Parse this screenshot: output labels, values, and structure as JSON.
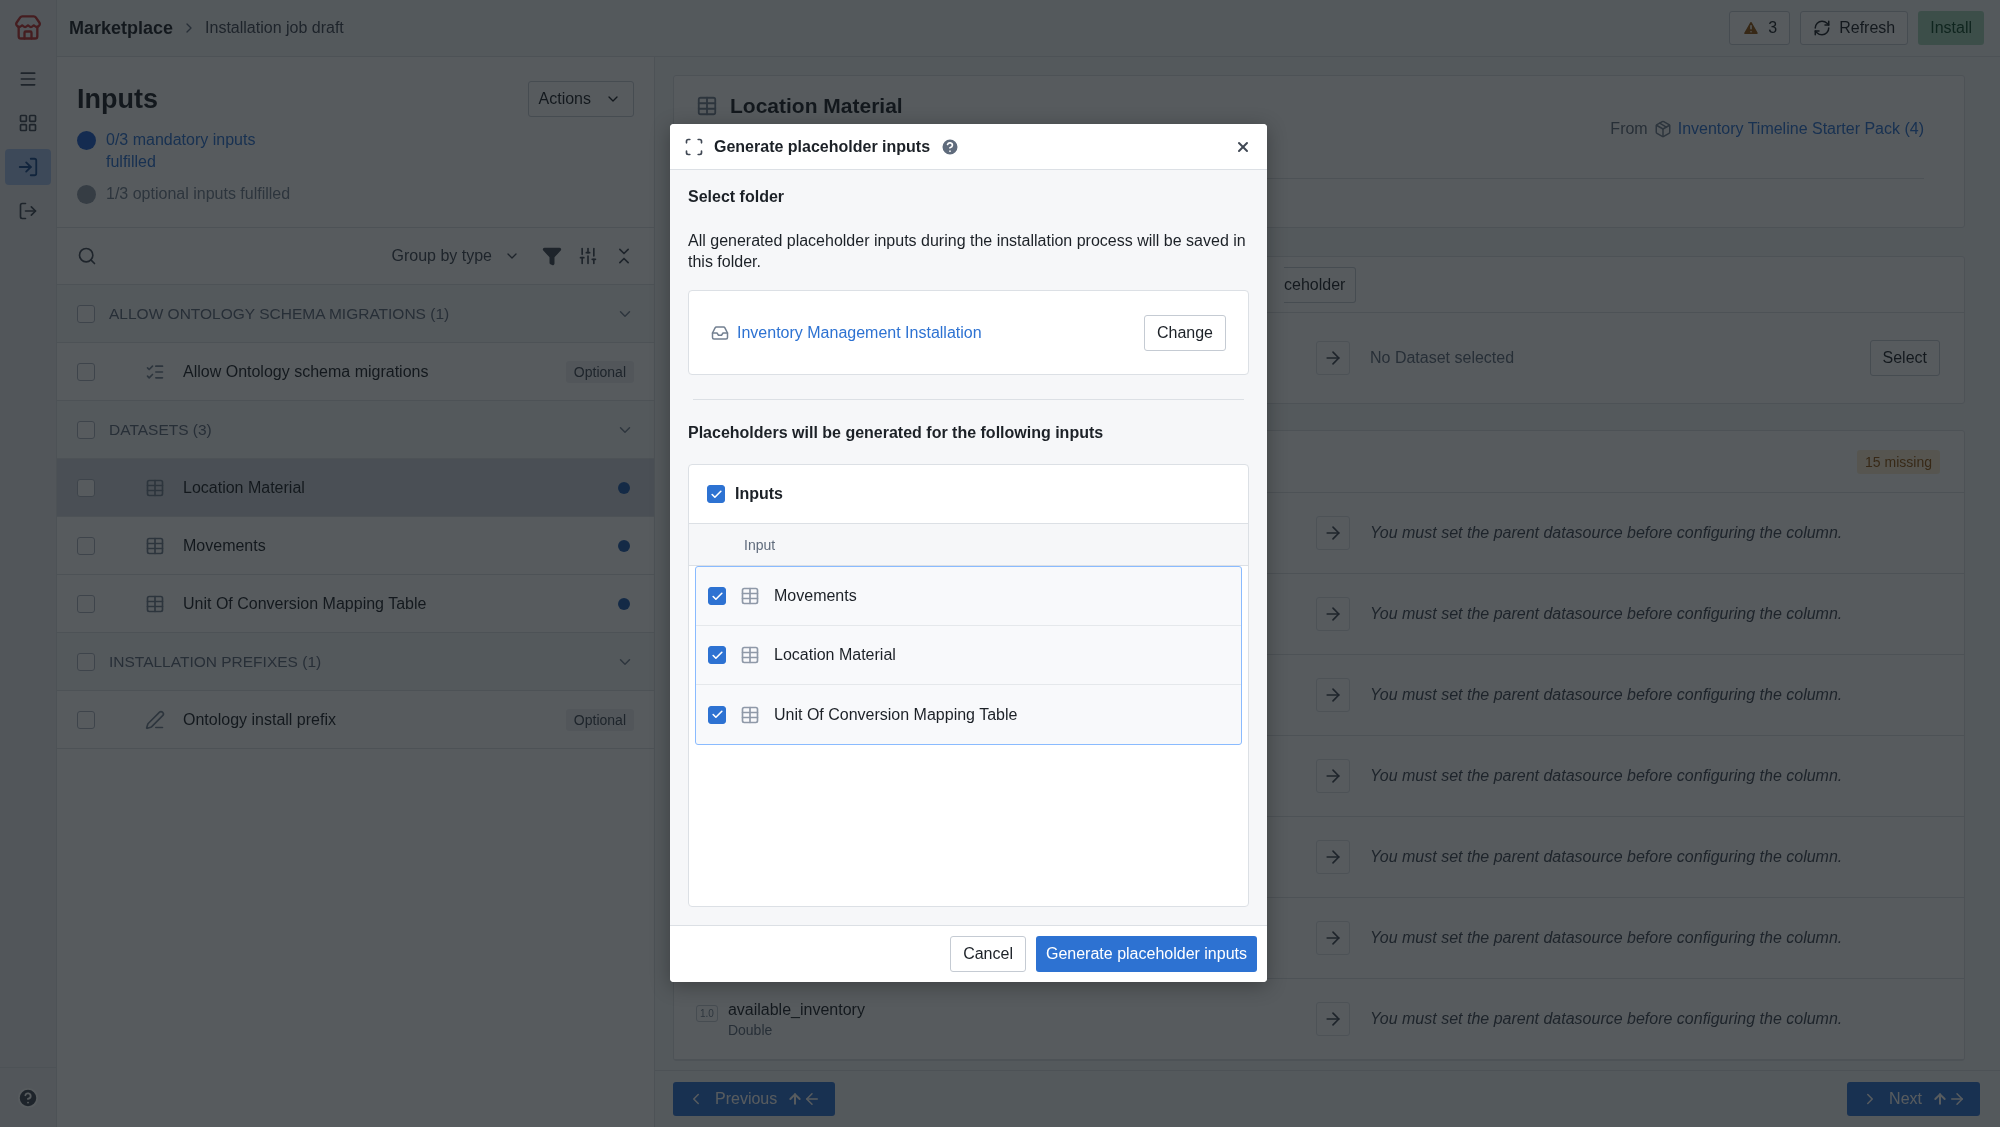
{
  "top_bar": {
    "breadcrumb": [
      "Marketplace",
      "Installation job draft"
    ],
    "warnings": "3",
    "refresh": "Refresh",
    "install": {
      "label": "Install",
      "disabled": true
    }
  },
  "nav_items": [
    {
      "kind": "menu",
      "selected": false
    },
    {
      "kind": "apps",
      "selected": false
    },
    {
      "kind": "inputs",
      "selected": true
    },
    {
      "kind": "outputs",
      "selected": false
    }
  ],
  "inputs_panel": {
    "title": "Inputs",
    "actions": "Actions",
    "statuses": [
      {
        "text": "0/3 mandatory inputs fulfilled",
        "link": true
      },
      {
        "text": "1/3 optional inputs fulfilled",
        "link": false
      }
    ],
    "group_by": "Group by type",
    "groups": [
      {
        "label": "ALLOW ONTOLOGY SCHEMA MIGRATIONS (1)",
        "checked": false,
        "expanded": true,
        "items": [
          {
            "kind": "toggle",
            "name": "Allow Ontology schema migrations",
            "checked": false,
            "selected": false,
            "required": false,
            "badge": "Optional"
          }
        ]
      },
      {
        "label": "DATASETS (3)",
        "checked": false,
        "expanded": true,
        "items": [
          {
            "kind": "dataset",
            "name": "Location Material",
            "checked": false,
            "selected": true,
            "required": true
          },
          {
            "kind": "dataset",
            "name": "Movements",
            "checked": false,
            "selected": false,
            "required": true
          },
          {
            "kind": "dataset",
            "name": "Unit Of Conversion Mapping Table",
            "checked": false,
            "selected": false,
            "required": true
          }
        ]
      },
      {
        "label": "INSTALLATION PREFIXES (1)",
        "checked": false,
        "expanded": true,
        "items": [
          {
            "kind": "prefix",
            "name": "Ontology install prefix",
            "checked": false,
            "selected": false,
            "required": false,
            "badge": "Optional"
          }
        ]
      }
    ]
  },
  "detail": {
    "title": "Location Material",
    "source_label": "From",
    "source": "Inventory Timeline Starter Pack (4)",
    "placeholder_button": "ceholder",
    "dataset_status": "No Dataset selected",
    "select": "Select",
    "missing": "15 missing",
    "columns": [
      {
        "message": "You must set the parent datasource before configuring the column."
      },
      {
        "message": "You must set the parent datasource before configuring the column."
      },
      {
        "message": "You must set the parent datasource before configuring the column."
      },
      {
        "message": "You must set the parent datasource before configuring the column."
      },
      {
        "message": "You must set the parent datasource before configuring the column."
      },
      {
        "message": "You must set the parent datasource before configuring the column."
      },
      {
        "name": "available_inventory",
        "type": "Double",
        "type_badge": "1.0",
        "message": "You must set the parent datasource before configuring the column."
      }
    ]
  },
  "footer": {
    "previous": "Previous",
    "next": "Next"
  },
  "dialog": {
    "title": "Generate placeholder inputs",
    "section_title": "Select folder",
    "description": "All generated placeholder inputs during the installation process will be saved in this folder.",
    "folder": "Inventory Management Installation",
    "change": "Change",
    "list_title": "Placeholders will be generated for the following inputs",
    "group": {
      "label": "Inputs",
      "checked": true
    },
    "column": "Input",
    "items": [
      {
        "name": "Movements",
        "checked": true
      },
      {
        "name": "Location Material",
        "checked": true
      },
      {
        "name": "Unit Of Conversion Mapping Table",
        "checked": true
      }
    ],
    "cancel": "Cancel",
    "confirm": "Generate placeholder inputs"
  }
}
